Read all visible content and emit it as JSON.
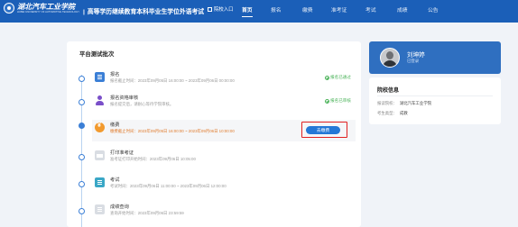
{
  "header": {
    "school_name": "湖北汽车工业学院",
    "school_name_en": "HUBEI UNIVERSITY OF AUTOMOTIVE TECHNOLOGY",
    "separator": "|",
    "site_title": "高等学历继续教育本科毕业生学位外语考试",
    "school_entry_label": "院校入口",
    "nav": [
      {
        "label": "首页",
        "active": true
      },
      {
        "label": "报名",
        "active": false
      },
      {
        "label": "缴费",
        "active": false
      },
      {
        "label": "准考证",
        "active": false
      },
      {
        "label": "考试",
        "active": false
      },
      {
        "label": "成绩",
        "active": false
      },
      {
        "label": "公告",
        "active": false
      }
    ],
    "background_color": "#1b5fb8"
  },
  "main": {
    "title": "平台测试批次",
    "steps": [
      {
        "icon": "document-icon",
        "title": "报名",
        "subtitle": "报名截止时间：2023年09月05日 16:00:00 ~ 2023年09月06日 00:00:00",
        "status": "报名已通过",
        "current": false
      },
      {
        "icon": "user-icon",
        "title": "报名资格审核",
        "subtitle": "报名提交后，请耐心等待学院审核。",
        "status": "报名已审核",
        "current": false
      },
      {
        "icon": "coin-icon",
        "title": "缴费",
        "subtitle": "缴费截止时间：2023年09月05日 16:00:00 ~ 2023年09月06日 10:00:00",
        "status": "",
        "current": true
      },
      {
        "icon": "printer-icon",
        "title": "打印准考证",
        "subtitle": "准考证打印开始时间：2023年09月06日 10:05:00",
        "status": "",
        "current": false
      },
      {
        "icon": "exam-icon",
        "title": "考试",
        "subtitle": "考试时间：2023年09月06日 11:00:00 ~ 2023年09月06日 12:00:00",
        "status": "",
        "current": false
      },
      {
        "icon": "score-icon",
        "title": "成绩查询",
        "subtitle": "查询开始时间：2023年09月06日 23:59:59",
        "status": "",
        "current": false
      }
    ],
    "pay_button_label": "去缴费",
    "accent_color": "#2478d6",
    "highlight_color": "#e02020"
  },
  "profile": {
    "name": "刘坤婷",
    "role": "已登录"
  },
  "school_info": {
    "title": "院校信息",
    "rows": [
      {
        "label": "报读院校：",
        "value": "湖北汽车工业学院"
      },
      {
        "label": "考生类型：",
        "value": "成教"
      }
    ]
  }
}
